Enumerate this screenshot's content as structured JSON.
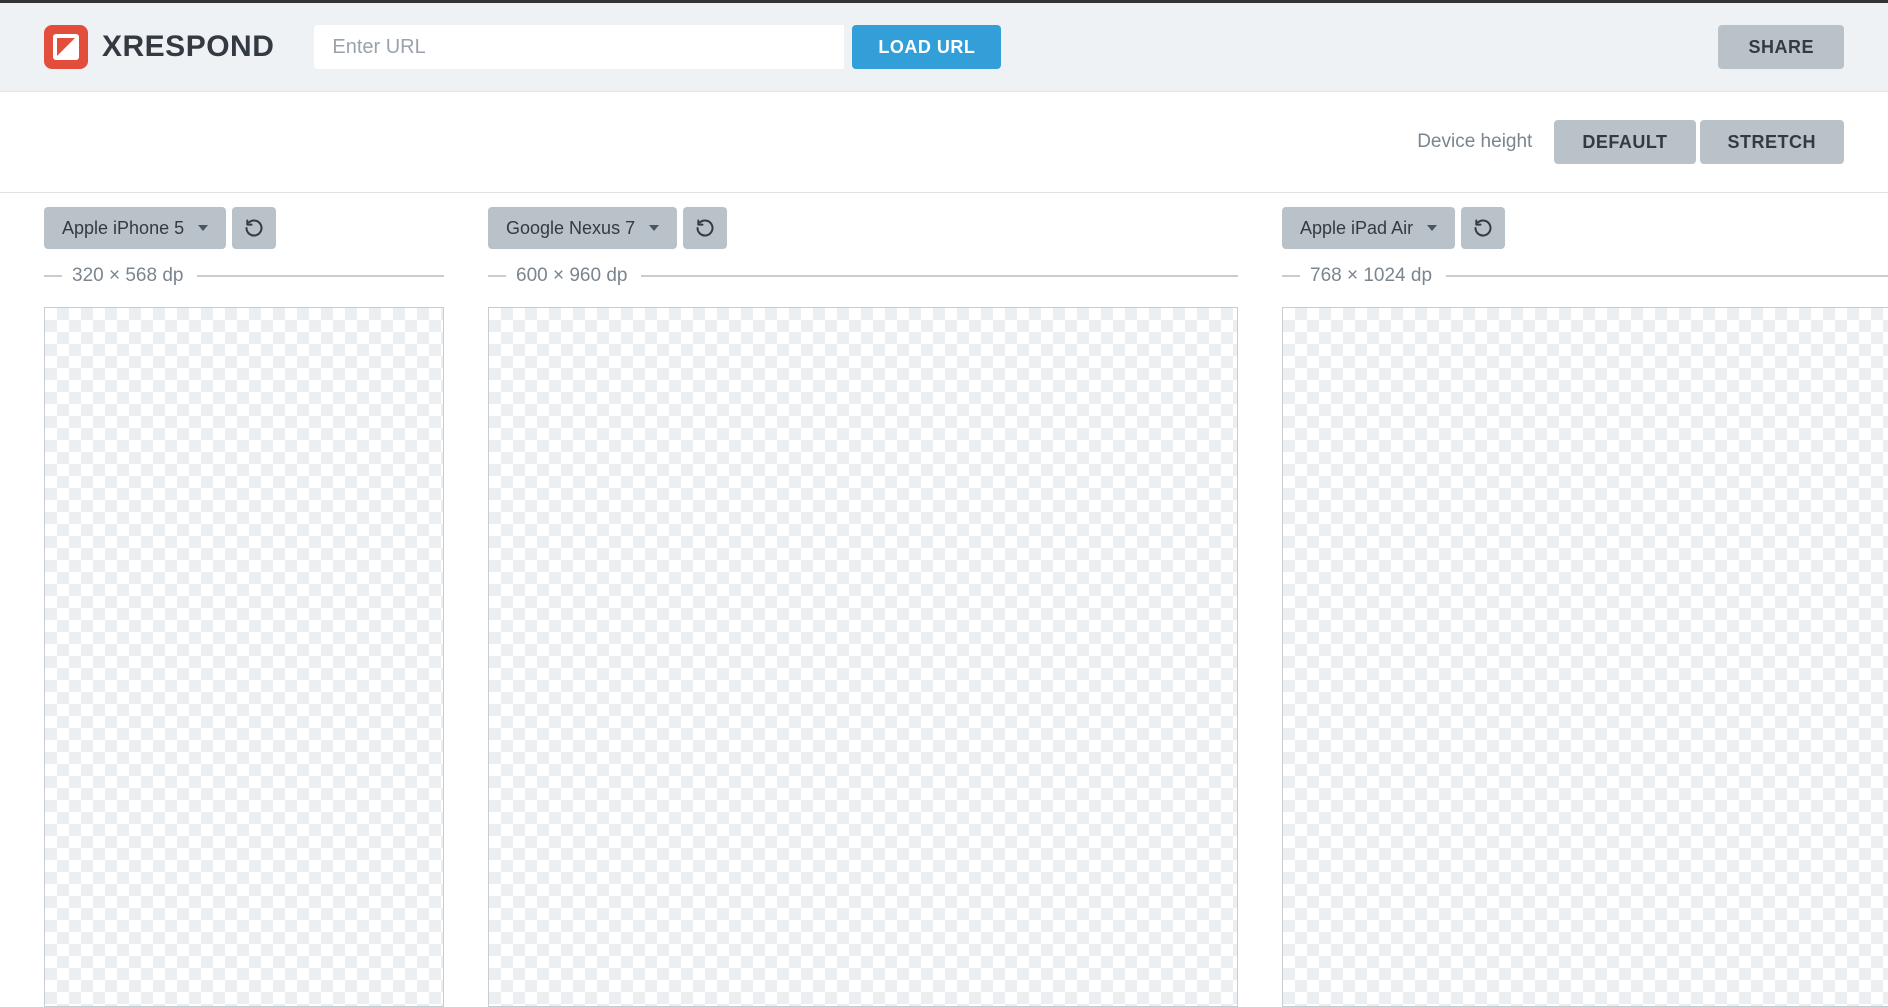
{
  "header": {
    "brand": "XRESPOND",
    "url_placeholder": "Enter URL",
    "load_label": "LOAD URL",
    "share_label": "SHARE"
  },
  "controls": {
    "device_height_label": "Device height",
    "default_label": "DEFAULT",
    "stretch_label": "STRETCH"
  },
  "frames": [
    {
      "device": "Apple iPhone 5",
      "dimensions": "320 × 568 dp"
    },
    {
      "device": "Google Nexus 7",
      "dimensions": "600 × 960 dp"
    },
    {
      "device": "Apple iPad Air",
      "dimensions": "768 × 1024 dp"
    }
  ]
}
